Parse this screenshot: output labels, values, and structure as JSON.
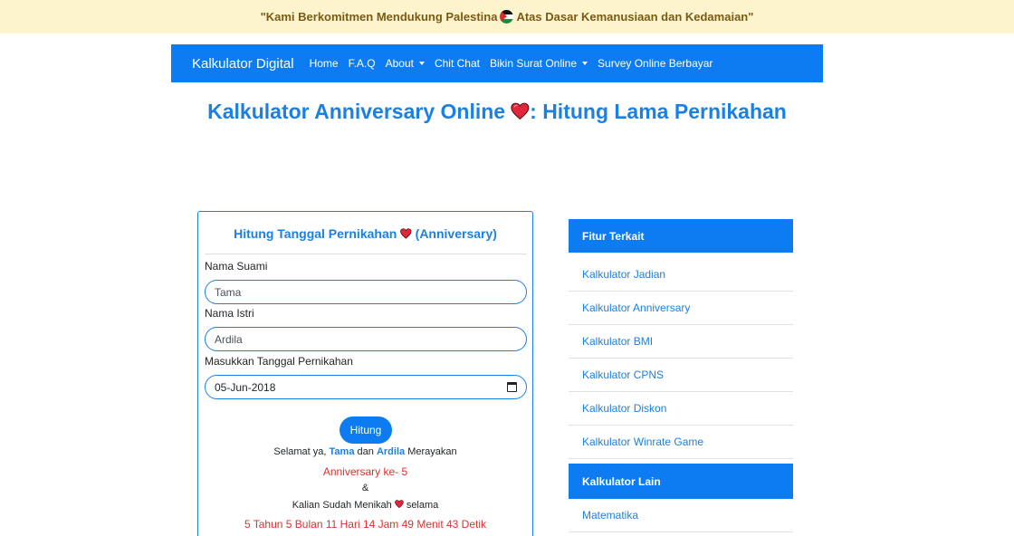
{
  "banner": {
    "text_before": "\"Kami Berkomitmen Mendukung Palestina",
    "text_after": "Atas Dasar Kemanusiaan dan Kedamaian\"",
    "flag_icon": "palestine-flag-icon"
  },
  "navbar": {
    "brand": "Kalkulator Digital",
    "links": [
      {
        "label": "Home"
      },
      {
        "label": "F.A.Q"
      },
      {
        "label": "About"
      },
      {
        "label": "Chit Chat"
      },
      {
        "label": "Bikin Surat Online"
      },
      {
        "label": "Survey Online Berbayar"
      }
    ],
    "color": "#0d7cf2"
  },
  "title": {
    "part1": "Kalkulator Anniversary Online",
    "part2": ": Hitung Lama Pernikahan"
  },
  "calculator": {
    "heading": "Hitung Tanggal Pernikahan",
    "heading_suffix": "(Anniversary)",
    "husband_label": "Nama Suami",
    "husband_value": "Tama",
    "wife_label": "Nama Istri",
    "wife_value": "Ardila",
    "date_label": "Masukkan Tanggal Pernikahan",
    "date_value": "05-Jun-2018",
    "button_label": "Hitung",
    "result": {
      "congrats_prefix": "Selamat ya,",
      "husband": "Tama",
      "and": "dan",
      "wife": "Ardila",
      "celebrating": "Merayakan",
      "anniversary": "Anniversary ke- 5",
      "ampersand": "&",
      "married_prefix": "Kalian Sudah Menikah",
      "married_suffix": "selama",
      "duration": "5 Tahun 5 Bulan 11 Hari 14 Jam 49 Menit 43 Detik"
    }
  },
  "sidebar": {
    "related_header": "Fitur Terkait",
    "related_items": [
      {
        "label": "Kalkulator Jadian"
      },
      {
        "label": "Kalkulator Anniversary"
      },
      {
        "label": "Kalkulator BMI"
      },
      {
        "label": "Kalkulator CPNS"
      },
      {
        "label": "Kalkulator Diskon"
      },
      {
        "label": "Kalkulator Winrate Game"
      }
    ],
    "other_header": "Kalkulator Lain",
    "other_items": [
      {
        "label": "Matematika"
      }
    ]
  },
  "colors": {
    "accent": "#1a80e6",
    "banner_bg": "#fdf3cd",
    "result_red": "#d9322f",
    "heart": "#e0263a"
  }
}
